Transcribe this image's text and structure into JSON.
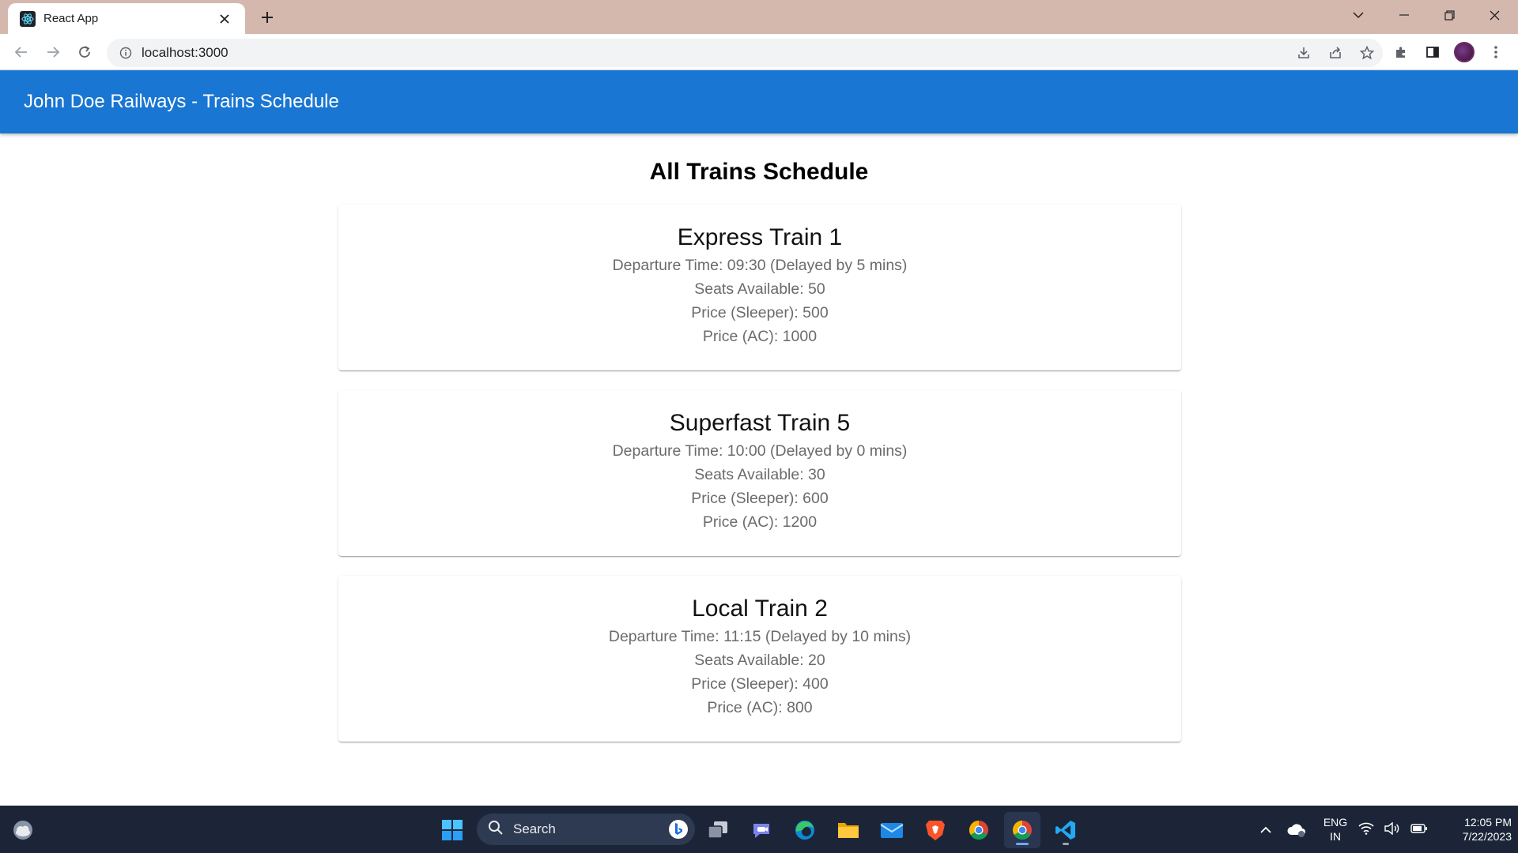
{
  "browser": {
    "tab_title": "React App",
    "url": "localhost:3000"
  },
  "app": {
    "header_title": "John Doe Railways - Trains Schedule",
    "page_title": "All Trains Schedule",
    "trains": [
      {
        "name": "Express Train 1",
        "departure": "Departure Time: 09:30 (Delayed by 5 mins)",
        "seats": "Seats Available: 50",
        "price_sleeper": "Price (Sleeper): 500",
        "price_ac": "Price (AC): 1000"
      },
      {
        "name": "Superfast Train 5",
        "departure": "Departure Time: 10:00 (Delayed by 0 mins)",
        "seats": "Seats Available: 30",
        "price_sleeper": "Price (Sleeper): 600",
        "price_ac": "Price (AC): 1200"
      },
      {
        "name": "Local Train 2",
        "departure": "Departure Time: 11:15 (Delayed by 10 mins)",
        "seats": "Seats Available: 20",
        "price_sleeper": "Price (Sleeper): 400",
        "price_ac": "Price (AC): 800"
      }
    ]
  },
  "taskbar": {
    "search_label": "Search",
    "language": "ENG",
    "region": "IN",
    "time": "12:05 PM",
    "date": "7/22/2023"
  },
  "colors": {
    "header_bg": "#1976d2",
    "titlebar_bg": "#d4b8ae",
    "taskbar_bg": "#1c2538"
  }
}
